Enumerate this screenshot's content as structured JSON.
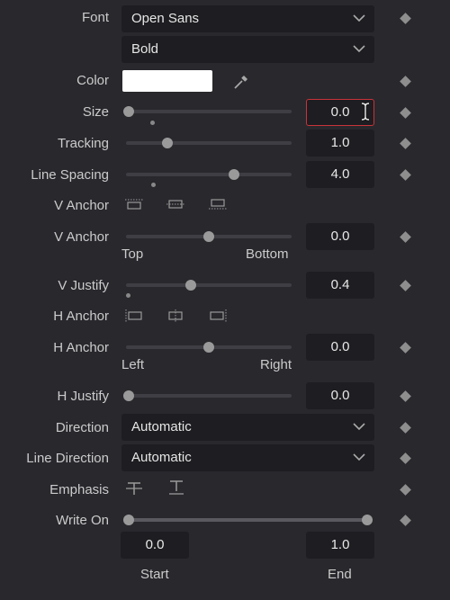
{
  "font": {
    "label": "Font",
    "family": "Open Sans",
    "style": "Bold"
  },
  "color": {
    "label": "Color",
    "swatch": "#ffffff"
  },
  "size": {
    "label": "Size",
    "value": "0.0",
    "slider_fraction": 0.0
  },
  "tracking": {
    "label": "Tracking",
    "value": "1.0",
    "slider_fraction": 0.25
  },
  "line_spacing": {
    "label": "Line Spacing",
    "value": "4.0",
    "slider_fraction": 0.65
  },
  "v_anchor_icons": {
    "label": "V Anchor"
  },
  "v_anchor": {
    "label": "V Anchor",
    "value": "0.0",
    "slider_fraction": 0.5,
    "min_label": "Top",
    "max_label": "Bottom"
  },
  "v_justify": {
    "label": "V Justify",
    "value": "0.4",
    "slider_fraction": 0.39
  },
  "h_anchor_icons": {
    "label": "H Anchor"
  },
  "h_anchor": {
    "label": "H Anchor",
    "value": "0.0",
    "slider_fraction": 0.5,
    "min_label": "Left",
    "max_label": "Right"
  },
  "h_justify": {
    "label": "H Justify",
    "value": "0.0",
    "slider_fraction": 0.0
  },
  "direction": {
    "label": "Direction",
    "value": "Automatic"
  },
  "line_direction": {
    "label": "Line Direction",
    "value": "Automatic"
  },
  "emphasis": {
    "label": "Emphasis"
  },
  "write_on": {
    "label": "Write On",
    "start": "0.0",
    "end": "1.0",
    "start_label": "Start",
    "end_label": "End"
  },
  "colors": {
    "background": "#29282d",
    "field": "#1e1d21",
    "active_border": "#c8333a"
  }
}
